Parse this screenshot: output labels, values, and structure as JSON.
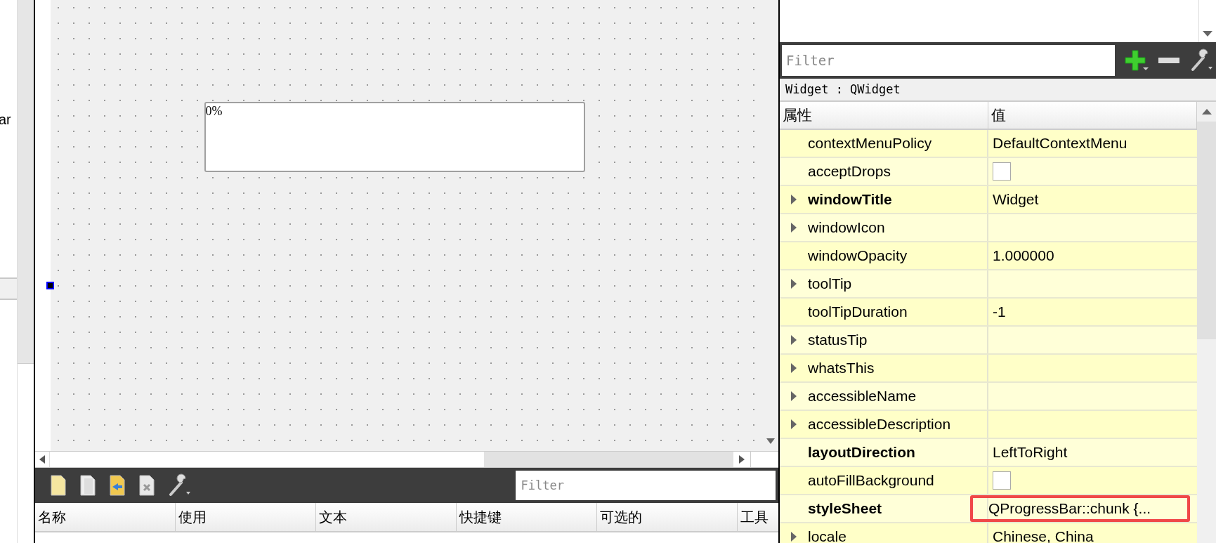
{
  "left_panel": {
    "text": "ar"
  },
  "form_canvas": {
    "progress_bar": {
      "text": "0%",
      "level": 0
    }
  },
  "action_editor": {
    "filter": {
      "placeholder": "Filter"
    },
    "columns": [
      "名称",
      "使用",
      "文本",
      "快捷键",
      "可选的",
      "工具"
    ]
  },
  "property_editor": {
    "filter": {
      "placeholder": "Filter"
    },
    "object_label": "Widget : QWidget",
    "columns": [
      "属性",
      "值"
    ],
    "rows": [
      {
        "name": "contextMenuPolicy",
        "kind": "text",
        "value": "DefaultContextMenu",
        "expandable": false,
        "modified": false,
        "highlighted": false
      },
      {
        "name": "acceptDrops",
        "kind": "checkbox",
        "checked": false,
        "expandable": false,
        "modified": false,
        "highlighted": false
      },
      {
        "name": "windowTitle",
        "kind": "text",
        "value": "Widget",
        "expandable": true,
        "modified": true,
        "highlighted": false
      },
      {
        "name": "windowIcon",
        "kind": "text",
        "expandable": true,
        "modified": false,
        "highlighted": false
      },
      {
        "name": "windowOpacity",
        "kind": "text",
        "value": "1.000000",
        "expandable": false,
        "modified": false,
        "highlighted": false
      },
      {
        "name": "toolTip",
        "kind": "text",
        "expandable": true,
        "modified": false,
        "highlighted": false
      },
      {
        "name": "toolTipDuration",
        "kind": "text",
        "value": "-1",
        "expandable": false,
        "modified": false,
        "highlighted": false
      },
      {
        "name": "statusTip",
        "kind": "text",
        "expandable": true,
        "modified": false,
        "highlighted": false
      },
      {
        "name": "whatsThis",
        "kind": "text",
        "expandable": true,
        "modified": false,
        "highlighted": false
      },
      {
        "name": "accessibleName",
        "kind": "text",
        "expandable": true,
        "modified": false,
        "highlighted": false
      },
      {
        "name": "accessibleDescription",
        "kind": "text",
        "expandable": true,
        "modified": false,
        "highlighted": false
      },
      {
        "name": "layoutDirection",
        "kind": "text",
        "value": "LeftToRight",
        "expandable": false,
        "modified": true,
        "highlighted": false
      },
      {
        "name": "autoFillBackground",
        "kind": "checkbox",
        "checked": false,
        "expandable": false,
        "modified": false,
        "highlighted": false
      },
      {
        "name": "styleSheet",
        "kind": "text",
        "value": "QProgressBar::chunk {...",
        "expandable": false,
        "modified": true,
        "highlighted": true
      },
      {
        "name": "locale",
        "kind": "text",
        "value": "Chinese, China",
        "expandable": true,
        "modified": false,
        "highlighted": false
      }
    ]
  }
}
